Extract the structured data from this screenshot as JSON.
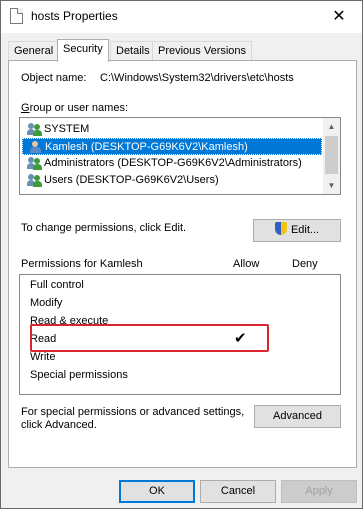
{
  "window": {
    "title": "hosts Properties",
    "close_label": "✕"
  },
  "tabs": [
    "General",
    "Security",
    "Details",
    "Previous Versions"
  ],
  "security": {
    "object_name_label": "Object name:",
    "object_name_value": "C:\\Windows\\System32\\drivers\\etc\\hosts",
    "group_label": "Group or user names:",
    "users": [
      "SYSTEM",
      "Kamlesh (DESKTOP-G69K6V2\\Kamlesh)",
      "Administrators (DESKTOP-G69K6V2\\Administrators)",
      "Users (DESKTOP-G69K6V2\\Users)"
    ],
    "change_text": "To change permissions, click Edit.",
    "edit_label": "Edit...",
    "permissions_label": "Permissions for Kamlesh",
    "allow_label": "Allow",
    "deny_label": "Deny",
    "permissions": [
      "Full control",
      "Modify",
      "Read & execute",
      "Read",
      "Write",
      "Special permissions"
    ],
    "checkmark": "✔",
    "advanced_text_1": "For special permissions or advanced settings,",
    "advanced_text_2": "click Advanced.",
    "advanced_label": "Advanced"
  },
  "footer": {
    "ok_label": "OK",
    "cancel_label": "Cancel",
    "apply_label": "Apply"
  },
  "colors": {
    "selection": "#0078d7",
    "highlight_box": "#d9232d"
  }
}
